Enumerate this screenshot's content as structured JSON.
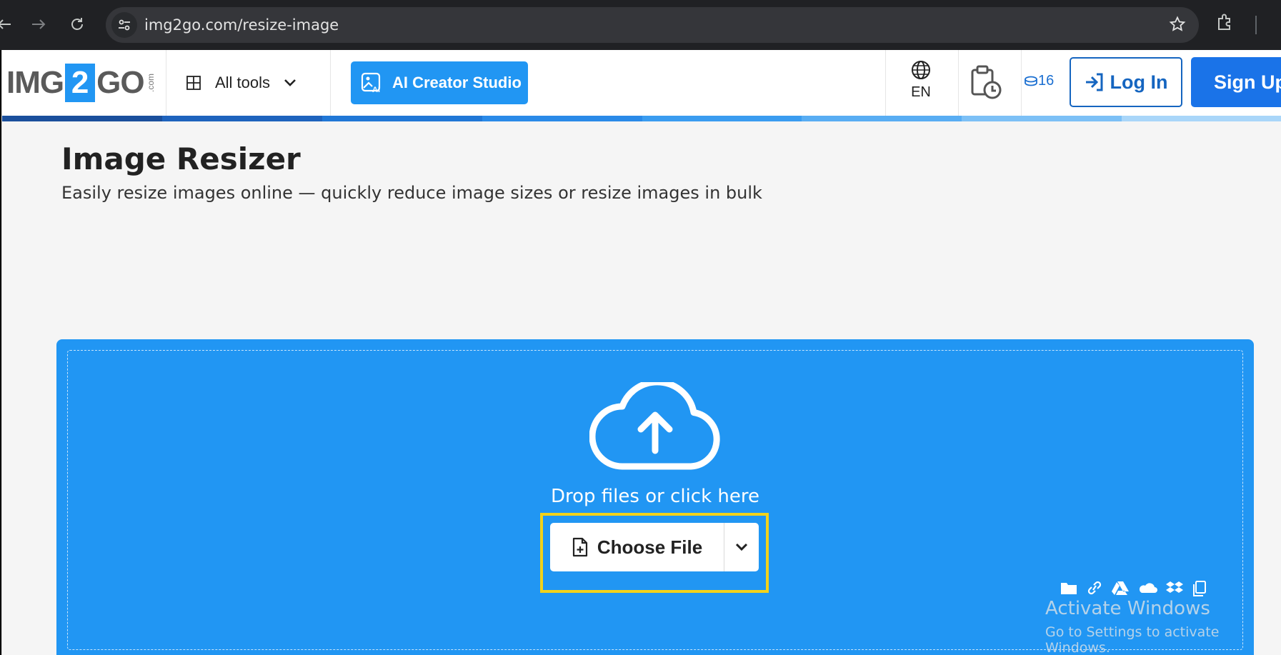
{
  "browser": {
    "url": "img2go.com/resize-image"
  },
  "nav": {
    "logo_left": "IMG",
    "logo_digit": "2",
    "logo_right": "GO",
    "logo_suffix": ".com",
    "all_tools": "All tools",
    "ai_creator": "AI Creator Studio",
    "language": "EN",
    "credits": "16",
    "login": "Log In",
    "signup": "Sign Up"
  },
  "main": {
    "title": "Image Resizer",
    "subtitle": "Easily resize images online — quickly reduce image sizes or resize images in bulk"
  },
  "upload": {
    "drop_text": "Drop files or click here",
    "choose_file": "Choose File",
    "sources": [
      "folder-icon",
      "link-icon",
      "google-drive-icon",
      "onedrive-icon",
      "dropbox-icon",
      "clipboard-icon"
    ]
  },
  "watermark": {
    "line1": "Activate Windows",
    "line2": "Go to Settings to activate Windows."
  },
  "colors": {
    "brand_blue": "#2196f3",
    "login_blue": "#1565c0",
    "signup_blue": "#1a73e8",
    "highlight": "#f2d21b"
  }
}
